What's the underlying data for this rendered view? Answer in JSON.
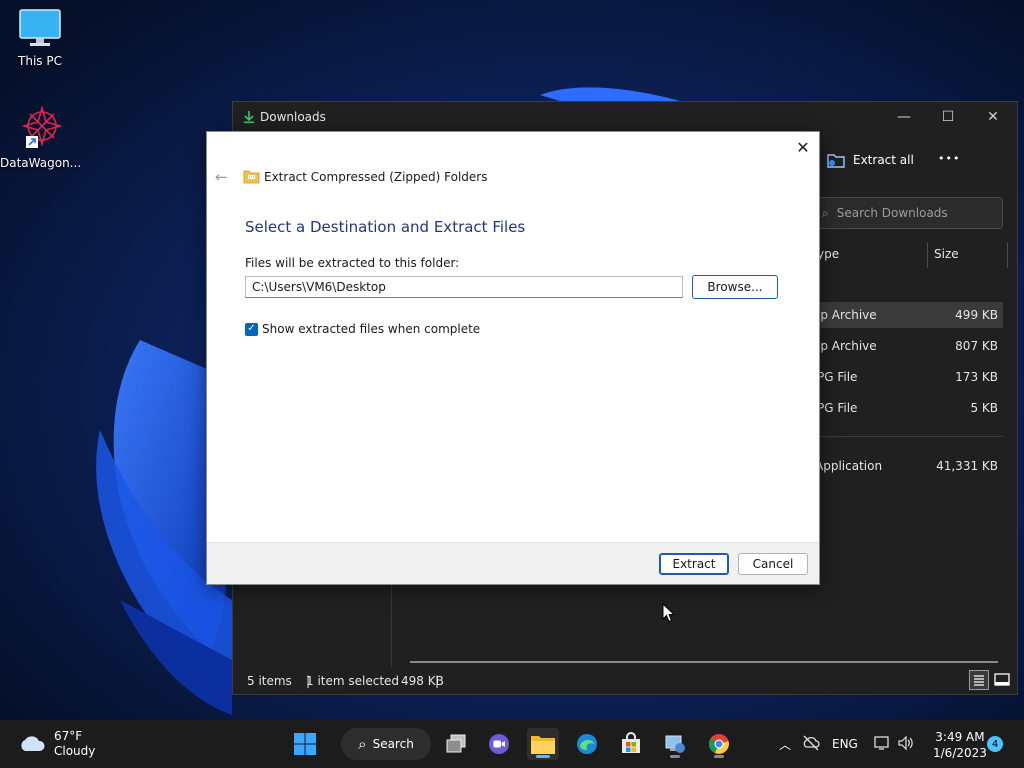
{
  "desktop": {
    "icons": [
      {
        "label": "This PC",
        "icon": "monitor-icon"
      },
      {
        "label": "DataWagon...",
        "icon": "datawagon-icon"
      }
    ]
  },
  "explorer": {
    "title": "Downloads",
    "toolbar": {
      "extract_all": "Extract all",
      "more": "•••"
    },
    "search_placeholder": "Search Downloads",
    "columns": {
      "type": "ype",
      "size": "Size"
    },
    "files": [
      {
        "type": "ip Archive",
        "size": "499 KB",
        "selected": true
      },
      {
        "type": "ip Archive",
        "size": "807 KB",
        "selected": false
      },
      {
        "type": "PG File",
        "size": "173 KB",
        "selected": false
      },
      {
        "type": "PG File",
        "size": "5 KB",
        "selected": false
      },
      {
        "type": "Application",
        "size": "41,331 KB",
        "selected": false
      }
    ],
    "status": {
      "items": "5 items",
      "selection": "1 item selected",
      "size": "498 KB",
      "divider": "|"
    }
  },
  "dialog": {
    "title": "Extract Compressed (Zipped) Folders",
    "heading": "Select a Destination and Extract Files",
    "dest_label": "Files will be extracted to this folder:",
    "path": "C:\\Users\\VM6\\Desktop",
    "browse": "Browse...",
    "show_files_label": "Show extracted files when complete",
    "show_files_checked": true,
    "extract": "Extract",
    "cancel": "Cancel"
  },
  "taskbar": {
    "weather": {
      "temp": "67°F",
      "condition": "Cloudy"
    },
    "search_label": "Search",
    "language": "ENG",
    "time": "3:49 AM",
    "date": "1/6/2023",
    "notifications": "4"
  },
  "colors": {
    "accent": "#0067c0",
    "heading": "#1e3a7a",
    "explorer_bg": "#202020",
    "taskbar_bg": "#1c1c1c"
  }
}
